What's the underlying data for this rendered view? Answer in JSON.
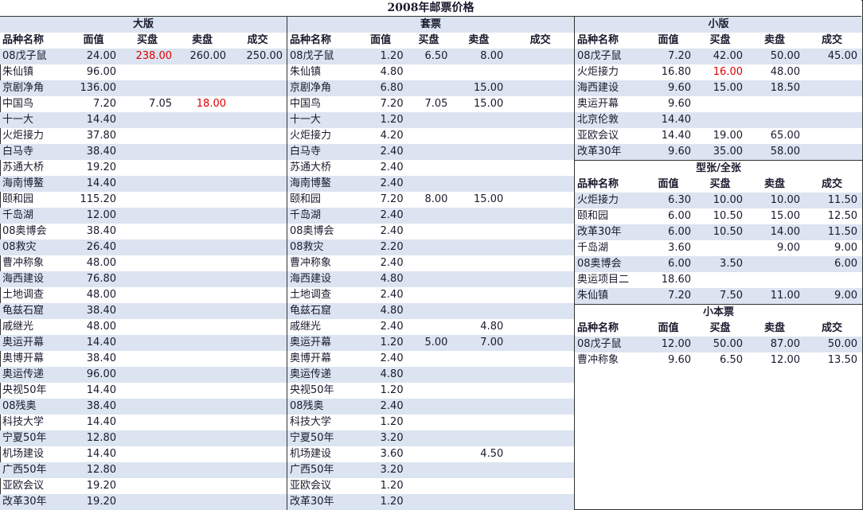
{
  "title": "2008年邮票价格",
  "headers": {
    "name": "品种名称",
    "face": "面值",
    "buy": "买盘",
    "sell": "卖盘",
    "deal": "成交"
  },
  "colors": {
    "row_alt": "#dbe4f0",
    "highlight": "#e00000",
    "border": "#333333"
  },
  "sections": {
    "dabancopy": null,
    "daban": {
      "title": "大版",
      "rows": [
        {
          "name": "08戊子鼠",
          "face": "24.00",
          "buy": "238.00",
          "sell": "260.00",
          "deal": "250.00",
          "red": [
            "buy"
          ]
        },
        {
          "name": "朱仙镇",
          "face": "96.00",
          "buy": "",
          "sell": "",
          "deal": ""
        },
        {
          "name": "京剧净角",
          "face": "136.00",
          "buy": "",
          "sell": "",
          "deal": ""
        },
        {
          "name": "中国鸟",
          "face": "7.20",
          "buy": "7.05",
          "sell": "18.00",
          "deal": "",
          "red": [
            "sell"
          ]
        },
        {
          "name": "十一大",
          "face": "14.40",
          "buy": "",
          "sell": "",
          "deal": ""
        },
        {
          "name": "火炬接力",
          "face": "37.80",
          "buy": "",
          "sell": "",
          "deal": ""
        },
        {
          "name": "白马寺",
          "face": "38.40",
          "buy": "",
          "sell": "",
          "deal": ""
        },
        {
          "name": "苏通大桥",
          "face": "19.20",
          "buy": "",
          "sell": "",
          "deal": ""
        },
        {
          "name": "海南博鳌",
          "face": "14.40",
          "buy": "",
          "sell": "",
          "deal": ""
        },
        {
          "name": "颐和园",
          "face": "115.20",
          "buy": "",
          "sell": "",
          "deal": ""
        },
        {
          "name": "千岛湖",
          "face": "12.00",
          "buy": "",
          "sell": "",
          "deal": ""
        },
        {
          "name": "08奥博会",
          "face": "38.40",
          "buy": "",
          "sell": "",
          "deal": ""
        },
        {
          "name": "08救灾",
          "face": "26.40",
          "buy": "",
          "sell": "",
          "deal": ""
        },
        {
          "name": "曹冲称象",
          "face": "48.00",
          "buy": "",
          "sell": "",
          "deal": ""
        },
        {
          "name": "海西建设",
          "face": "76.80",
          "buy": "",
          "sell": "",
          "deal": ""
        },
        {
          "name": "土地调查",
          "face": "48.00",
          "buy": "",
          "sell": "",
          "deal": ""
        },
        {
          "name": "龟兹石窟",
          "face": "38.40",
          "buy": "",
          "sell": "",
          "deal": ""
        },
        {
          "name": "戚继光",
          "face": "48.00",
          "buy": "",
          "sell": "",
          "deal": ""
        },
        {
          "name": "奥运开幕",
          "face": "14.40",
          "buy": "",
          "sell": "",
          "deal": ""
        },
        {
          "name": "奥博开幕",
          "face": "38.40",
          "buy": "",
          "sell": "",
          "deal": ""
        },
        {
          "name": "奥运传递",
          "face": "96.00",
          "buy": "",
          "sell": "",
          "deal": ""
        },
        {
          "name": "央视50年",
          "face": "14.40",
          "buy": "",
          "sell": "",
          "deal": ""
        },
        {
          "name": "08残奥",
          "face": "38.40",
          "buy": "",
          "sell": "",
          "deal": ""
        },
        {
          "name": "科技大学",
          "face": "14.40",
          "buy": "",
          "sell": "",
          "deal": ""
        },
        {
          "name": "宁夏50年",
          "face": "12.80",
          "buy": "",
          "sell": "",
          "deal": ""
        },
        {
          "name": "机场建设",
          "face": "14.40",
          "buy": "",
          "sell": "",
          "deal": ""
        },
        {
          "name": "广西50年",
          "face": "12.80",
          "buy": "",
          "sell": "",
          "deal": ""
        },
        {
          "name": "亚欧会议",
          "face": "19.20",
          "buy": "",
          "sell": "",
          "deal": ""
        },
        {
          "name": "改革30年",
          "face": "19.20",
          "buy": "",
          "sell": "",
          "deal": ""
        }
      ]
    },
    "taopiao": {
      "title": "套票",
      "rows": [
        {
          "name": "08戊子鼠",
          "face": "1.20",
          "buy": "6.50",
          "sell": "8.00",
          "deal": ""
        },
        {
          "name": "朱仙镇",
          "face": "4.80",
          "buy": "",
          "sell": "",
          "deal": ""
        },
        {
          "name": "京剧净角",
          "face": "6.80",
          "buy": "",
          "sell": "15.00",
          "deal": ""
        },
        {
          "name": "中国鸟",
          "face": "7.20",
          "buy": "7.05",
          "sell": "15.00",
          "deal": ""
        },
        {
          "name": "十一大",
          "face": "1.20",
          "buy": "",
          "sell": "",
          "deal": ""
        },
        {
          "name": "火炬接力",
          "face": "4.20",
          "buy": "",
          "sell": "",
          "deal": ""
        },
        {
          "name": "白马寺",
          "face": "2.40",
          "buy": "",
          "sell": "",
          "deal": ""
        },
        {
          "name": "苏通大桥",
          "face": "2.40",
          "buy": "",
          "sell": "",
          "deal": ""
        },
        {
          "name": "海南博鳌",
          "face": "2.40",
          "buy": "",
          "sell": "",
          "deal": ""
        },
        {
          "name": "颐和园",
          "face": "7.20",
          "buy": "8.00",
          "sell": "15.00",
          "deal": ""
        },
        {
          "name": "千岛湖",
          "face": "2.40",
          "buy": "",
          "sell": "",
          "deal": ""
        },
        {
          "name": "08奥博会",
          "face": "2.40",
          "buy": "",
          "sell": "",
          "deal": ""
        },
        {
          "name": "08救灾",
          "face": "2.20",
          "buy": "",
          "sell": "",
          "deal": ""
        },
        {
          "name": "曹冲称象",
          "face": "2.40",
          "buy": "",
          "sell": "",
          "deal": ""
        },
        {
          "name": "海西建设",
          "face": "4.80",
          "buy": "",
          "sell": "",
          "deal": ""
        },
        {
          "name": "土地调查",
          "face": "2.40",
          "buy": "",
          "sell": "",
          "deal": ""
        },
        {
          "name": "龟兹石窟",
          "face": "4.80",
          "buy": "",
          "sell": "",
          "deal": ""
        },
        {
          "name": "戚继光",
          "face": "2.40",
          "buy": "",
          "sell": "4.80",
          "deal": ""
        },
        {
          "name": "奥运开幕",
          "face": "1.20",
          "buy": "5.00",
          "sell": "7.00",
          "deal": ""
        },
        {
          "name": "奥博开幕",
          "face": "2.40",
          "buy": "",
          "sell": "",
          "deal": ""
        },
        {
          "name": "奥运传递",
          "face": "4.80",
          "buy": "",
          "sell": "",
          "deal": ""
        },
        {
          "name": "央视50年",
          "face": "1.20",
          "buy": "",
          "sell": "",
          "deal": ""
        },
        {
          "name": "08残奥",
          "face": "2.40",
          "buy": "",
          "sell": "",
          "deal": ""
        },
        {
          "name": "科技大学",
          "face": "1.20",
          "buy": "",
          "sell": "",
          "deal": ""
        },
        {
          "name": "宁夏50年",
          "face": "3.20",
          "buy": "",
          "sell": "",
          "deal": ""
        },
        {
          "name": "机场建设",
          "face": "3.60",
          "buy": "",
          "sell": "4.50",
          "deal": ""
        },
        {
          "name": "广西50年",
          "face": "3.20",
          "buy": "",
          "sell": "",
          "deal": ""
        },
        {
          "name": "亚欧会议",
          "face": "1.20",
          "buy": "",
          "sell": "",
          "deal": ""
        },
        {
          "name": "改革30年",
          "face": "1.20",
          "buy": "",
          "sell": "",
          "deal": ""
        }
      ]
    },
    "xiaoban": {
      "title": "小版",
      "rows": [
        {
          "name": "08戊子鼠",
          "face": "7.20",
          "buy": "42.00",
          "sell": "50.00",
          "deal": "45.00"
        },
        {
          "name": "火炬接力",
          "face": "16.80",
          "buy": "16.00",
          "sell": "48.00",
          "deal": "",
          "red": [
            "buy"
          ]
        },
        {
          "name": "海西建设",
          "face": "9.60",
          "buy": "15.00",
          "sell": "18.50",
          "deal": ""
        },
        {
          "name": "奥运开幕",
          "face": "9.60",
          "buy": "",
          "sell": "",
          "deal": ""
        },
        {
          "name": "北京伦敦",
          "face": "14.40",
          "buy": "",
          "sell": "",
          "deal": ""
        },
        {
          "name": "亚欧会议",
          "face": "14.40",
          "buy": "19.00",
          "sell": "65.00",
          "deal": ""
        },
        {
          "name": "改革30年",
          "face": "9.60",
          "buy": "35.00",
          "sell": "58.00",
          "deal": ""
        }
      ]
    },
    "xingzhang": {
      "title": "型张/全张",
      "rows": [
        {
          "name": "火炬接力",
          "face": "6.30",
          "buy": "10.00",
          "sell": "10.00",
          "deal": "11.50"
        },
        {
          "name": "颐和园",
          "face": "6.00",
          "buy": "10.50",
          "sell": "15.00",
          "deal": "12.50"
        },
        {
          "name": "改革30年",
          "face": "6.00",
          "buy": "10.50",
          "sell": "14.00",
          "deal": "11.50"
        },
        {
          "name": "千岛湖",
          "face": "3.60",
          "buy": "",
          "sell": "9.00",
          "deal": "9.00"
        },
        {
          "name": "08奥博会",
          "face": "6.00",
          "buy": "3.50",
          "sell": "",
          "deal": "6.00"
        },
        {
          "name": "奥运项目二",
          "face": "18.60",
          "buy": "",
          "sell": "",
          "deal": ""
        },
        {
          "name": "朱仙镇",
          "face": "7.20",
          "buy": "7.50",
          "sell": "11.00",
          "deal": "9.00"
        }
      ]
    },
    "xiaobenpiao": {
      "title": "小本票",
      "rows": [
        {
          "name": "08戊子鼠",
          "face": "12.00",
          "buy": "50.00",
          "sell": "87.00",
          "deal": "50.00"
        },
        {
          "name": "曹冲称象",
          "face": "9.60",
          "buy": "6.50",
          "sell": "12.00",
          "deal": "13.50"
        }
      ]
    }
  }
}
